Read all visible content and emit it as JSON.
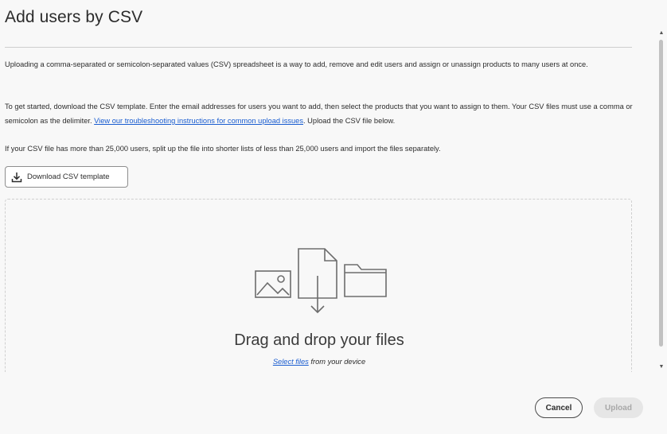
{
  "dialog": {
    "title": "Add users by CSV",
    "paragraph1": "Uploading a comma-separated or semicolon-separated values (CSV) spreadsheet is a way to add, remove and edit users and assign or unassign products to many users at once.",
    "paragraph2_before_link": "To get started, download the CSV template. Enter the email addresses for users you want to add, then select the products that you want to assign to them. Your CSV files must use a comma or semicolon as the delimiter. ",
    "paragraph2_link": "View our troubleshooting instructions for common upload issues",
    "paragraph2_after_link": ". Upload the CSV file below.",
    "paragraph3": "If your CSV file has more than 25,000 users, split up the file into shorter lists of less than 25,000 users and import the files separately.",
    "download_button_label": "Download CSV template",
    "download_icon": "download-icon"
  },
  "dropzone": {
    "title": "Drag and drop your files",
    "select_link": "Select files",
    "select_suffix": " from your device",
    "icons": [
      "image-icon",
      "file-download-icon",
      "folder-icon"
    ]
  },
  "footer": {
    "cancel_label": "Cancel",
    "upload_label": "Upload"
  },
  "colors": {
    "link": "#1a5dd0",
    "text": "#2c2c2c",
    "background": "#f8f8f8",
    "disabled_button_bg": "#e6e6e6"
  }
}
